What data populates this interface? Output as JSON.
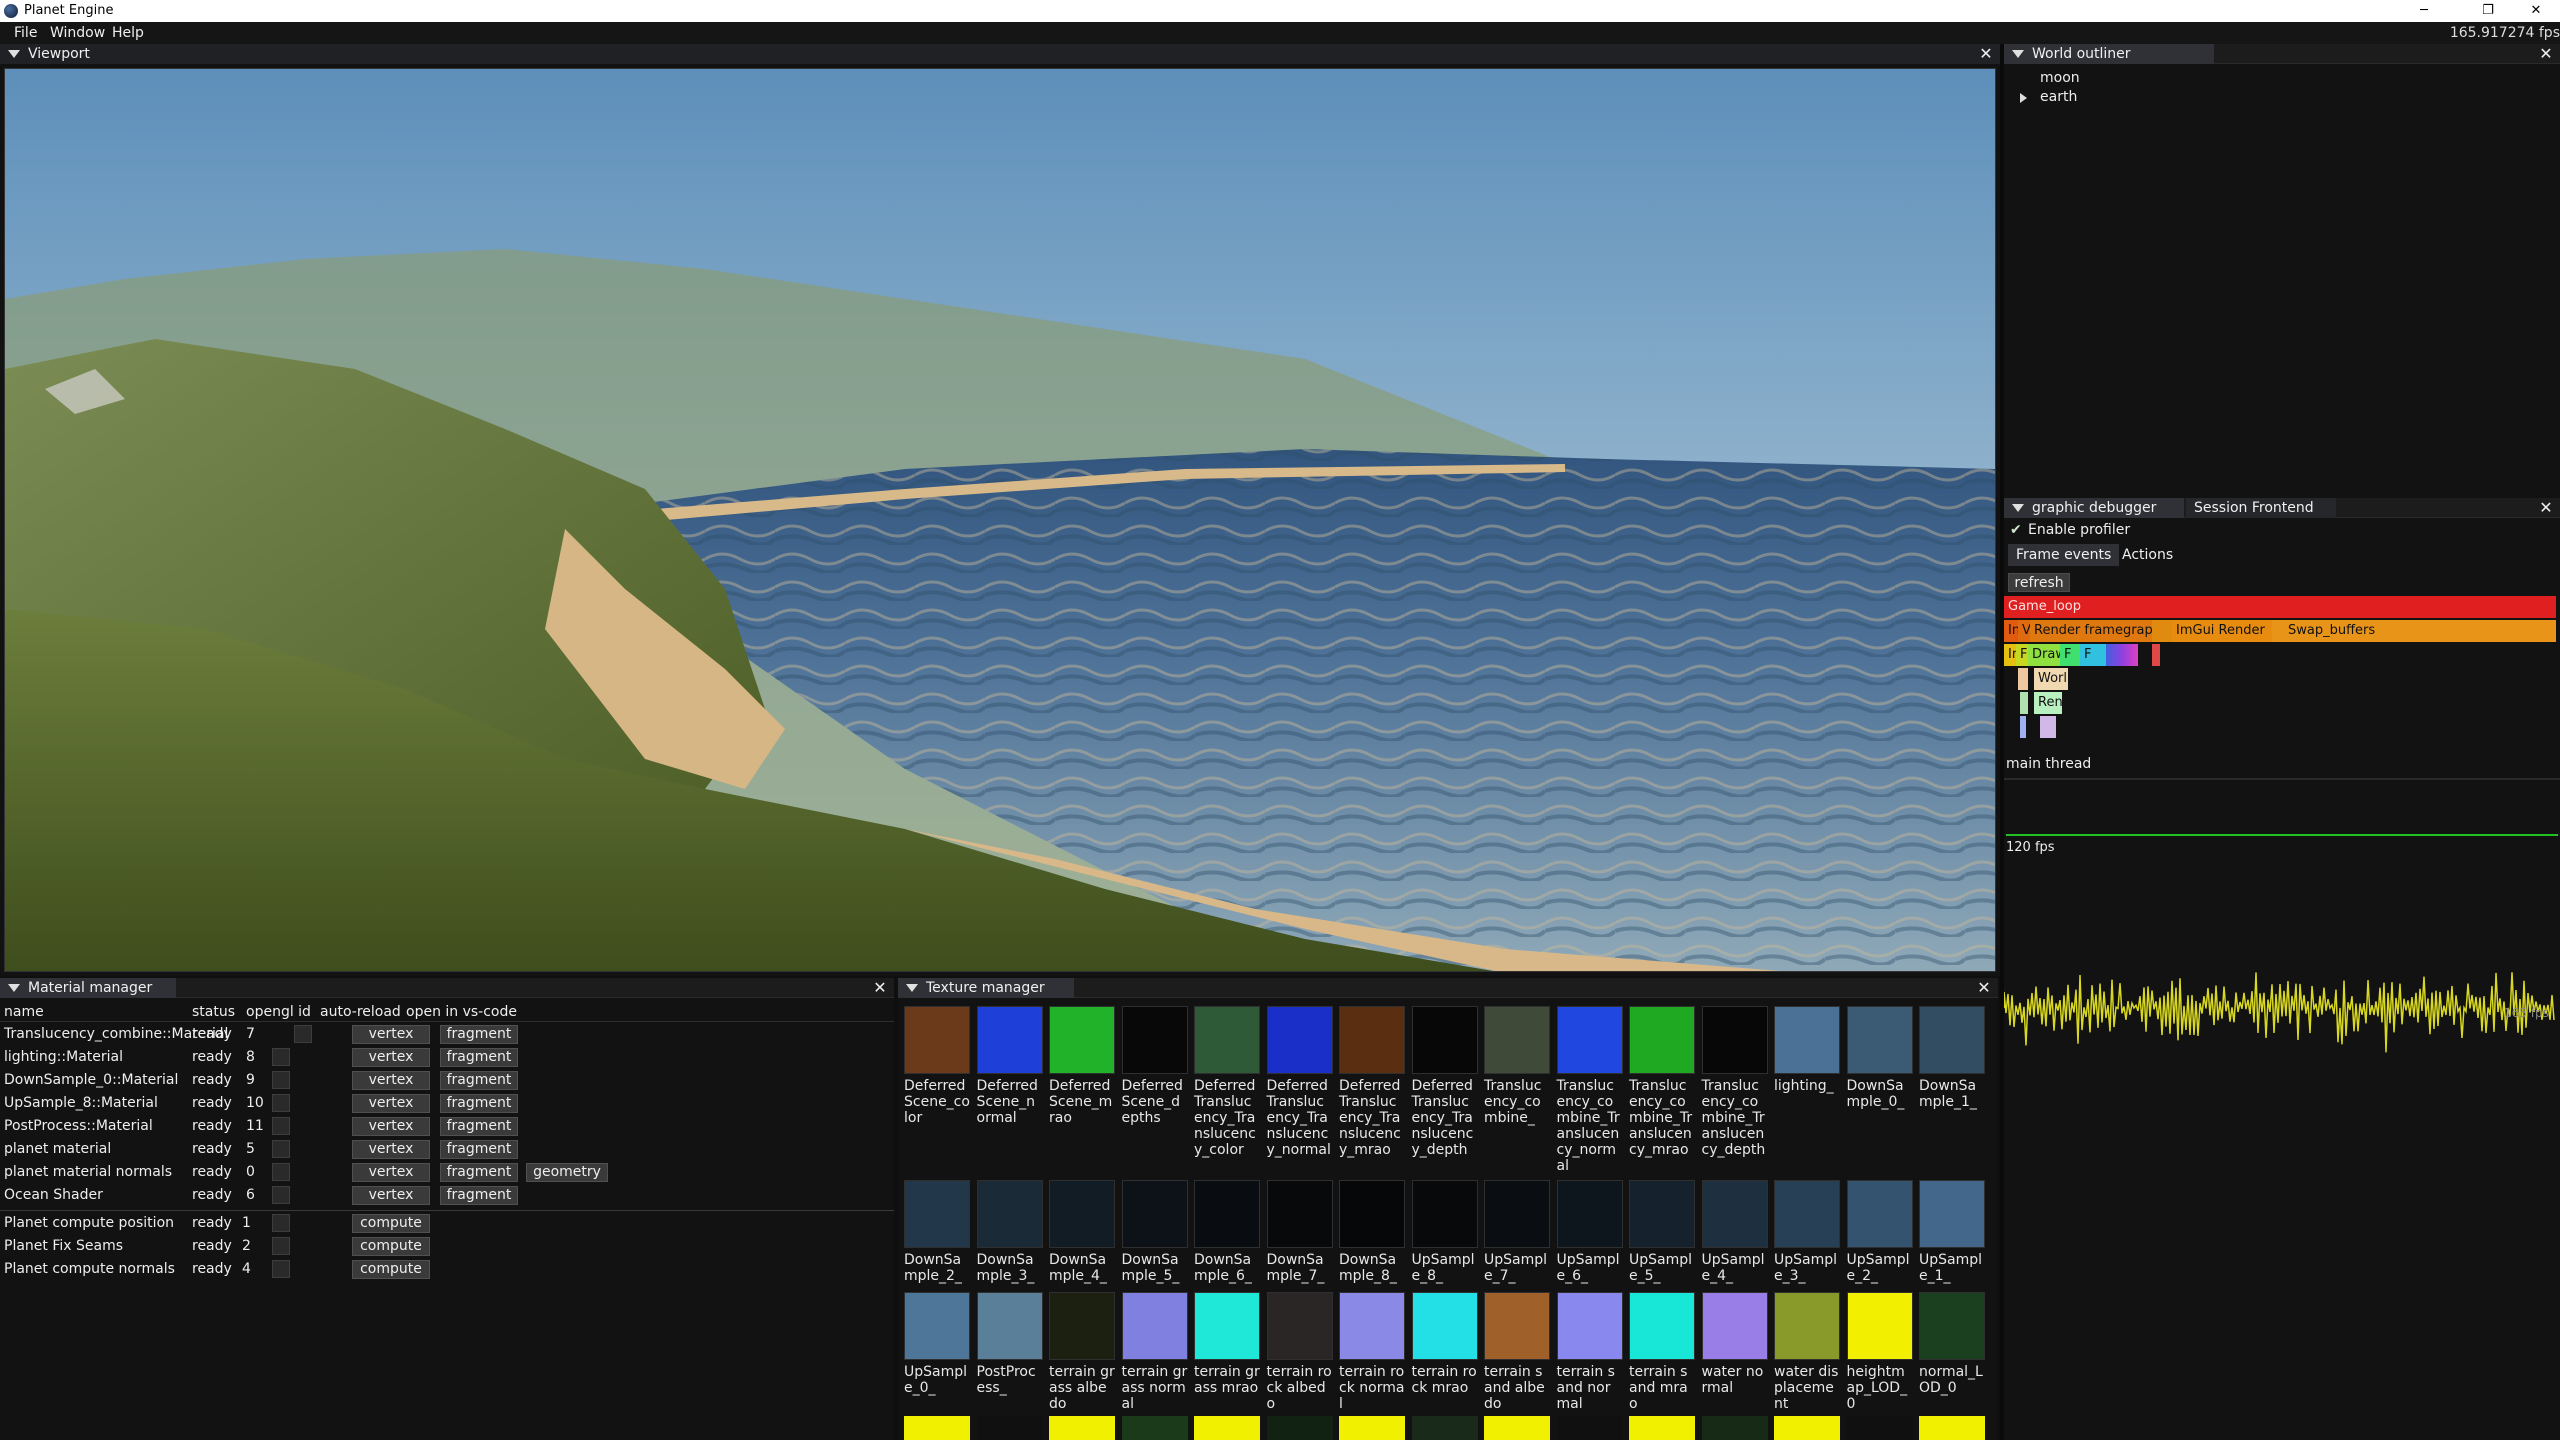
{
  "app": {
    "title": "Planet Engine"
  },
  "menu": {
    "items": [
      "File",
      "Window",
      "Help"
    ],
    "fps": "165.917274 fps"
  },
  "viewport": {
    "tab": "Viewport"
  },
  "outliner": {
    "tab": "World outliner",
    "items": [
      "moon",
      "earth"
    ]
  },
  "debugger": {
    "tabs": [
      "graphic debugger",
      "Session Frontend"
    ],
    "enable_profiler": "Enable profiler",
    "subtabs": [
      "Frame events",
      "Actions"
    ],
    "refresh": "refresh",
    "bars": {
      "game_loop": "Game_loop",
      "in": "In",
      "v": "V",
      "render_framegraph": "Render framegraph",
      "imgui": "ImGui Render",
      "swap": "Swap_buffers",
      "l3": [
        "Ir",
        "F",
        "Draw",
        "F",
        "F"
      ],
      "worl": "Worl",
      "ren": "Ren"
    },
    "thread": "main thread",
    "fps_label": "120 fps",
    "fps_right": "165 fps"
  },
  "material_manager": {
    "tab": "Material manager",
    "headers": [
      "name",
      "status",
      "opengl id",
      "auto-reload",
      "open in vs-code"
    ],
    "rows": [
      {
        "name": "Translucency_combine::Material",
        "status": "ready",
        "id": "7",
        "buttons": [
          "vertex",
          "fragment"
        ]
      },
      {
        "name": "lighting::Material",
        "status": "ready",
        "id": "8",
        "buttons": [
          "vertex",
          "fragment"
        ]
      },
      {
        "name": "DownSample_0::Material",
        "status": "ready",
        "id": "9",
        "buttons": [
          "vertex",
          "fragment"
        ]
      },
      {
        "name": "UpSample_8::Material",
        "status": "ready",
        "id": "10",
        "buttons": [
          "vertex",
          "fragment"
        ]
      },
      {
        "name": "PostProcess::Material",
        "status": "ready",
        "id": "11",
        "buttons": [
          "vertex",
          "fragment"
        ]
      },
      {
        "name": "planet material",
        "status": "ready",
        "id": "5",
        "buttons": [
          "vertex",
          "fragment"
        ]
      },
      {
        "name": "planet material normals",
        "status": "ready",
        "id": "0",
        "buttons": [
          "vertex",
          "fragment",
          "geometry"
        ]
      },
      {
        "name": "Ocean Shader",
        "status": "ready",
        "id": "6",
        "buttons": [
          "vertex",
          "fragment"
        ]
      }
    ],
    "compute_rows": [
      {
        "name": "Planet compute position",
        "status": "ready",
        "id": "1",
        "button": "compute"
      },
      {
        "name": "Planet Fix Seams",
        "status": "ready",
        "id": "2",
        "button": "compute"
      },
      {
        "name": "Planet compute normals",
        "status": "ready",
        "id": "4",
        "button": "compute"
      }
    ]
  },
  "texture_manager": {
    "tab": "Texture manager",
    "textures": [
      {
        "label": "Deferred Scene_color",
        "color": "#6a3a1a"
      },
      {
        "label": "Deferred Scene_normal",
        "color": "#1e3fd8"
      },
      {
        "label": "Deferred Scene_mrao",
        "color": "#22b22a"
      },
      {
        "label": "Deferred Scene_depths",
        "color": "#080808"
      },
      {
        "label": "Deferred Translucency_Translucency_color",
        "color": "#2f5a38"
      },
      {
        "label": "Deferred Translucency_Translucency_normal",
        "color": "#1a2ec8"
      },
      {
        "label": "Deferred Translucency_Translucency_mrao",
        "color": "#5a2e10"
      },
      {
        "label": "Deferred Translucency_Translucency_depth",
        "color": "#070707"
      },
      {
        "label": "Translucency_combine_",
        "color": "#3f4a38"
      },
      {
        "label": "Translucency_combine_Translucency_normal",
        "color": "#2048e0"
      },
      {
        "label": "Translucency_combine_Translucency_mrao",
        "color": "#1fa822"
      },
      {
        "label": "Translucency_combine_Translucency_depth",
        "color": "#070707"
      },
      {
        "label": "lighting_",
        "color": "#4b7196"
      },
      {
        "label": "DownSample_0_",
        "color": "#3b5a74"
      },
      {
        "label": "DownSample_1_",
        "color": "#324d62"
      },
      {
        "label": "DownSample_2_",
        "color": "#22384a"
      },
      {
        "label": "DownSample_3_",
        "color": "#1a2a36"
      },
      {
        "label": "DownSample_4_",
        "color": "#111c24"
      },
      {
        "label": "DownSample_5_",
        "color": "#0c1218"
      },
      {
        "label": "DownSample_6_",
        "color": "#090c10"
      },
      {
        "label": "DownSample_7_",
        "color": "#07090b"
      },
      {
        "label": "DownSample_8_",
        "color": "#060708"
      },
      {
        "label": "UpSample_8_",
        "color": "#07090b"
      },
      {
        "label": "UpSample_7_",
        "color": "#0a0e12"
      },
      {
        "label": "UpSample_6_",
        "color": "#0e161d"
      },
      {
        "label": "UpSample_5_",
        "color": "#15222d"
      },
      {
        "label": "UpSample_4_",
        "color": "#1e3040"
      },
      {
        "label": "UpSample_3_",
        "color": "#284056"
      },
      {
        "label": "UpSample_2_",
        "color": "#34536f"
      },
      {
        "label": "UpSample_1_",
        "color": "#43678a"
      },
      {
        "label": "UpSample_0_",
        "color": "#4e7698"
      },
      {
        "label": "PostProcess_",
        "color": "#5a7f98"
      },
      {
        "label": "terrain grass albedo",
        "color": "#1b2010"
      },
      {
        "label": "terrain grass normal",
        "color": "#8080e0"
      },
      {
        "label": "terrain grass mrao",
        "color": "#20e8d8"
      },
      {
        "label": "terrain rock albedo",
        "color": "#2a2626"
      },
      {
        "label": "terrain rock normal",
        "color": "#8a8ae6"
      },
      {
        "label": "terrain rock mrao",
        "color": "#22e0e6"
      },
      {
        "label": "terrain sand albedo",
        "color": "#a0602a"
      },
      {
        "label": "terrain sand normal",
        "color": "#8888ee"
      },
      {
        "label": "terrain sand mrao",
        "color": "#18e6d6"
      },
      {
        "label": "water normal",
        "color": "#9a7ee8"
      },
      {
        "label": "water displacement",
        "color": "#8a9a2a"
      },
      {
        "label": "heightmap_LOD_0",
        "color": "#f2f000"
      },
      {
        "label": "normal_LOD_0",
        "color": "#1a4020"
      }
    ]
  }
}
